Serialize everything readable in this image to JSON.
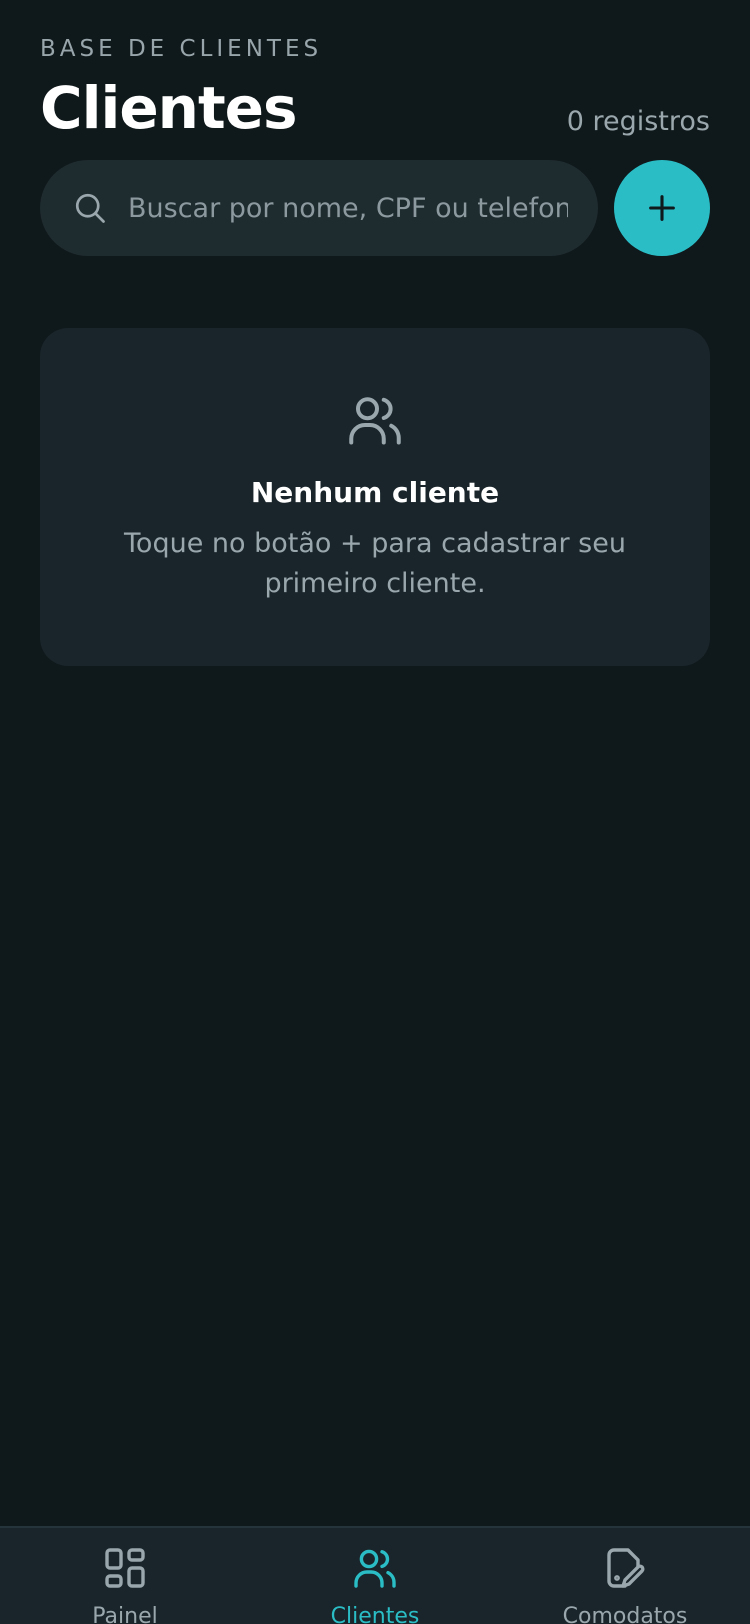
{
  "header": {
    "eyebrow": "BASE DE CLIENTES",
    "title": "Clientes",
    "count": "0 registros"
  },
  "search": {
    "placeholder": "Buscar por nome, CPF ou telefone",
    "value": "",
    "icon": "search-icon"
  },
  "add_button": {
    "icon": "plus-icon"
  },
  "empty_state": {
    "icon": "users-icon",
    "title": "Nenhum cliente",
    "text": "Toque no botão + para cadastrar seu primeiro cliente."
  },
  "bottom_nav": {
    "items": [
      {
        "label": "Painel",
        "icon": "dashboard-grid-icon",
        "active": false
      },
      {
        "label": "Clientes",
        "icon": "users-icon",
        "active": true
      },
      {
        "label": "Comodatos",
        "icon": "document-edit-icon",
        "active": false
      }
    ]
  },
  "colors": {
    "background": "#0f181b",
    "surface": "#19252a",
    "accent": "#2bbdc6",
    "muted_text": "#9aa8ad"
  }
}
